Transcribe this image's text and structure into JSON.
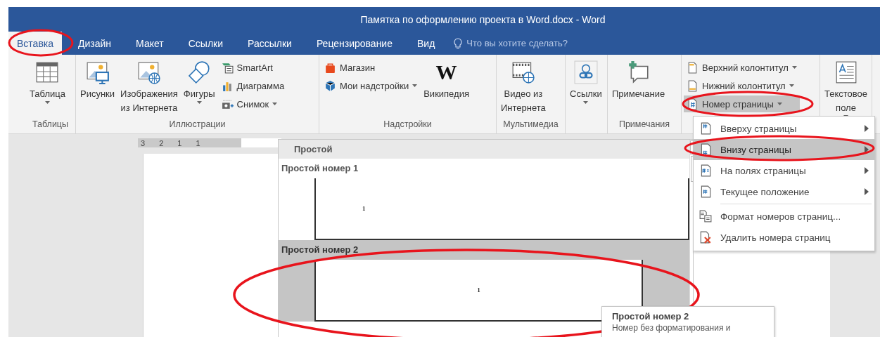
{
  "window": {
    "title": "Памятка по оформлению проекта в Word.docx - Word"
  },
  "tabs": [
    {
      "label": "Вставка",
      "selected": true
    },
    {
      "label": "Дизайн",
      "selected": false
    },
    {
      "label": "Макет",
      "selected": false
    },
    {
      "label": "Ссылки",
      "selected": false
    },
    {
      "label": "Рассылки",
      "selected": false
    },
    {
      "label": "Рецензирование",
      "selected": false
    },
    {
      "label": "Вид",
      "selected": false
    }
  ],
  "tell_me": {
    "placeholder": "Что вы хотите сделать?"
  },
  "ribbon_groups": [
    {
      "label": "Таблицы",
      "buttons": [
        {
          "kind": "large",
          "label": "Таблица",
          "dropdown": true
        }
      ]
    },
    {
      "label": "Иллюстрации",
      "buttons": [
        {
          "kind": "large",
          "label": "Рисунки",
          "dropdown": false
        },
        {
          "kind": "large",
          "label": "Изображения\nиз Интернета",
          "dropdown": false
        },
        {
          "kind": "large",
          "label": "Фигуры",
          "dropdown": true
        },
        {
          "kind": "small",
          "label": "SmartArt",
          "dropdown": false,
          "selected": false
        },
        {
          "kind": "small",
          "label": "Диаграмма",
          "dropdown": false,
          "selected": false
        },
        {
          "kind": "small",
          "label": "Снимок",
          "dropdown": true,
          "selected": false
        }
      ]
    },
    {
      "label": "Надстройки",
      "buttons": [
        {
          "kind": "small",
          "label": "Магазин",
          "dropdown": false,
          "selected": false
        },
        {
          "kind": "small",
          "label": "Мои надстройки",
          "dropdown": true,
          "selected": false
        },
        {
          "kind": "logo",
          "logo": "W",
          "label": "Википедия",
          "dropdown": false
        }
      ]
    },
    {
      "label": "Мультимедиа",
      "buttons": [
        {
          "kind": "large",
          "label": "Видео из\nИнтернета",
          "dropdown": false
        }
      ]
    },
    {
      "buttons": [
        {
          "kind": "large",
          "label": "Ссылки",
          "dropdown": true
        }
      ]
    },
    {
      "label": "Примечания",
      "buttons": [
        {
          "kind": "large",
          "label": "Примечание",
          "dropdown": false
        }
      ]
    },
    {
      "buttons": [
        {
          "kind": "small",
          "label": "Верхний колонтитул",
          "dropdown": true,
          "selected": false
        },
        {
          "kind": "small",
          "label": "Нижний колонтитул",
          "dropdown": true,
          "selected": false
        },
        {
          "kind": "small",
          "label": "Номер страницы",
          "dropdown": true,
          "selected": true
        }
      ]
    },
    {
      "buttons": [
        {
          "kind": "large",
          "label": "Текстовое\nполе",
          "dropdown": true
        }
      ]
    }
  ],
  "ruler": {
    "labels": [
      "3",
      "2",
      "1",
      "1"
    ]
  },
  "gallery": {
    "header": "Простой",
    "items": [
      {
        "title": "Простой номер 1",
        "selected": false,
        "number": "1",
        "kind": "left"
      },
      {
        "title": "Простой номер 2",
        "selected": true,
        "number": "1",
        "kind": "center"
      }
    ]
  },
  "menu": [
    {
      "label": "Вверху страницы",
      "selected": false,
      "submenu": true
    },
    {
      "label": "Внизу страницы",
      "selected": true,
      "submenu": true
    },
    {
      "label": "На полях страницы",
      "selected": false,
      "submenu": true
    },
    {
      "label": "Текущее положение",
      "selected": false,
      "submenu": true
    },
    {
      "label": "Формат номеров страниц...",
      "selected": false,
      "submenu": false,
      "separator_before": true
    },
    {
      "label": "Удалить номера страниц",
      "selected": false,
      "submenu": false
    }
  ],
  "tooltip": {
    "title": "Простой номер 2",
    "text": "Номер без форматирования и"
  }
}
